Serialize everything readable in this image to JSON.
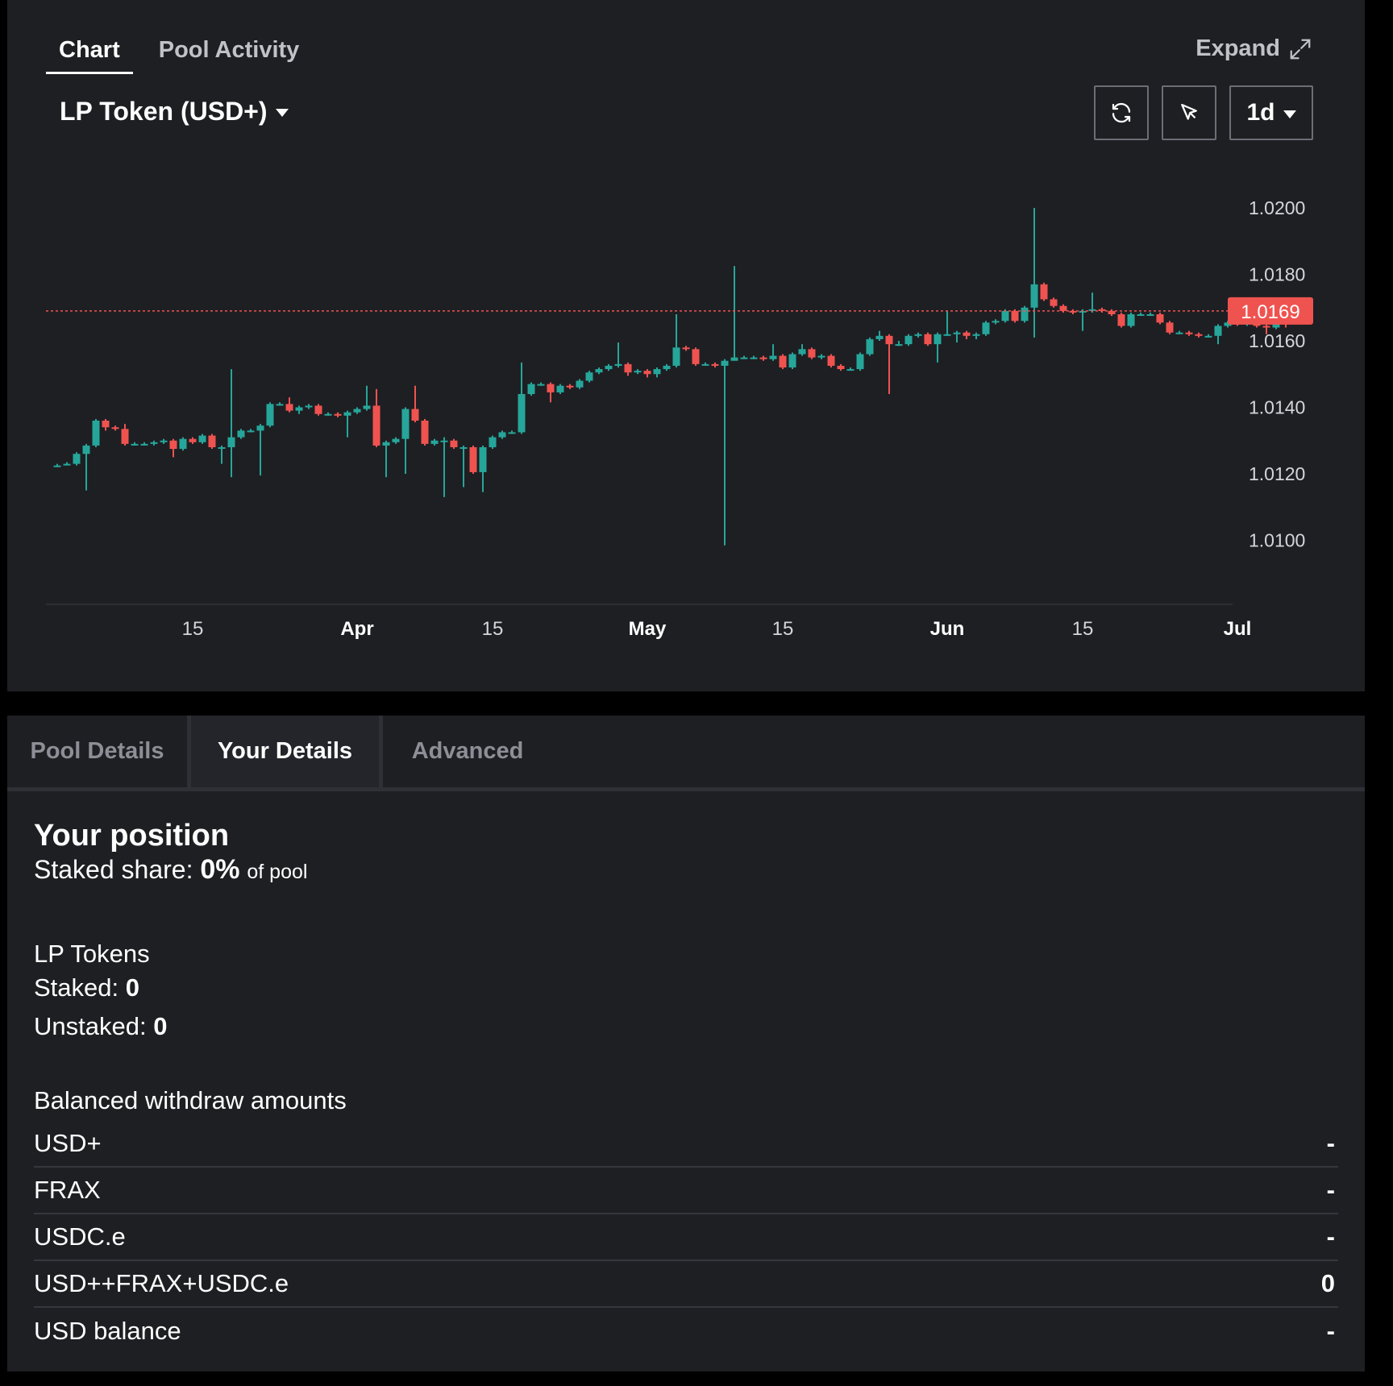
{
  "top_tabs": [
    "Chart",
    "Pool Activity"
  ],
  "expand_label": "Expand",
  "token_select": "LP Token (USD+)",
  "interval": "1d",
  "icons": {
    "refresh": "refresh-icon",
    "cursor": "cursor-icon",
    "expand": "expand-icon",
    "dropdown": "chevron-down-icon"
  },
  "colors": {
    "up": "#26a69a",
    "down": "#ef5350",
    "background": "#1e1f23",
    "price_tag": "#ef5350"
  },
  "chart_data": {
    "type": "candlestick",
    "y_ticks": [
      "1.0200",
      "1.0180",
      "1.0160",
      "1.0140",
      "1.0120",
      "1.0100"
    ],
    "y_tick_values": [
      1.02,
      1.018,
      1.016,
      1.014,
      1.012,
      1.01
    ],
    "ylim": [
      1.0095,
      1.0215
    ],
    "x_ticks": [
      {
        "label": "15",
        "bold": false,
        "day": 14
      },
      {
        "label": "Apr",
        "bold": true,
        "day": 31
      },
      {
        "label": "15",
        "bold": false,
        "day": 45
      },
      {
        "label": "May",
        "bold": true,
        "day": 61
      },
      {
        "label": "15",
        "bold": false,
        "day": 75
      },
      {
        "label": "Jun",
        "bold": true,
        "day": 92
      },
      {
        "label": "15",
        "bold": false,
        "day": 106
      },
      {
        "label": "Jul",
        "bold": true,
        "day": 122
      }
    ],
    "current_price": "1.0169",
    "current_value": 1.0169,
    "candles": [
      [
        1.01225,
        1.01225,
        1.0122,
        1.0123
      ],
      [
        1.0123,
        1.0123,
        1.01225,
        1.01235
      ],
      [
        1.0123,
        1.0126,
        1.01225,
        1.01265
      ],
      [
        1.0126,
        1.01285,
        1.0115,
        1.0129
      ],
      [
        1.01285,
        1.0136,
        1.0128,
        1.01365
      ],
      [
        1.0136,
        1.0134,
        1.0133,
        1.01365
      ],
      [
        1.0134,
        1.01335,
        1.0133,
        1.01345
      ],
      [
        1.01335,
        1.0129,
        1.01285,
        1.0135
      ],
      [
        1.0129,
        1.0129,
        1.01285,
        1.01295
      ],
      [
        1.0129,
        1.0129,
        1.01285,
        1.01295
      ],
      [
        1.0129,
        1.01295,
        1.01285,
        1.013
      ],
      [
        1.01295,
        1.013,
        1.0129,
        1.01305
      ],
      [
        1.013,
        1.01275,
        1.0125,
        1.01305
      ],
      [
        1.01275,
        1.01305,
        1.0127,
        1.0131
      ],
      [
        1.01305,
        1.01295,
        1.0129,
        1.0131
      ],
      [
        1.01295,
        1.01315,
        1.0129,
        1.0132
      ],
      [
        1.01315,
        1.0128,
        1.01275,
        1.0132
      ],
      [
        1.0128,
        1.0128,
        1.0123,
        1.01285
      ],
      [
        1.0128,
        1.0131,
        1.0119,
        1.01515
      ],
      [
        1.0131,
        1.0133,
        1.01305,
        1.01335
      ],
      [
        1.0133,
        1.0133,
        1.01325,
        1.01335
      ],
      [
        1.0133,
        1.01345,
        1.01195,
        1.0135
      ],
      [
        1.01345,
        1.0141,
        1.0134,
        1.01415
      ],
      [
        1.0141,
        1.0141,
        1.01405,
        1.01415
      ],
      [
        1.0141,
        1.0139,
        1.01385,
        1.0143
      ],
      [
        1.0139,
        1.014,
        1.0138,
        1.01405
      ],
      [
        1.014,
        1.01405,
        1.01395,
        1.0141
      ],
      [
        1.01405,
        1.0138,
        1.01375,
        1.0141
      ],
      [
        1.0138,
        1.0138,
        1.01375,
        1.01385
      ],
      [
        1.0138,
        1.01375,
        1.0137,
        1.01385
      ],
      [
        1.01375,
        1.01385,
        1.0131,
        1.0139
      ],
      [
        1.01385,
        1.01395,
        1.0138,
        1.014
      ],
      [
        1.01395,
        1.01405,
        1.0139,
        1.01465
      ],
      [
        1.01405,
        1.01285,
        1.0128,
        1.01455
      ],
      [
        1.01285,
        1.01295,
        1.0119,
        1.013
      ],
      [
        1.01295,
        1.01305,
        1.0129,
        1.0131
      ],
      [
        1.01305,
        1.01395,
        1.012,
        1.014
      ],
      [
        1.01395,
        1.0136,
        1.01355,
        1.01465
      ],
      [
        1.0136,
        1.0129,
        1.01285,
        1.01365
      ],
      [
        1.0129,
        1.013,
        1.01285,
        1.01305
      ],
      [
        1.013,
        1.013,
        1.0113,
        1.0131
      ],
      [
        1.013,
        1.0128,
        1.01275,
        1.01305
      ],
      [
        1.0128,
        1.0128,
        1.0116,
        1.01285
      ],
      [
        1.0128,
        1.01205,
        1.012,
        1.01285
      ],
      [
        1.01205,
        1.0128,
        1.01145,
        1.01285
      ],
      [
        1.0128,
        1.0131,
        1.01275,
        1.01315
      ],
      [
        1.0131,
        1.01325,
        1.01305,
        1.0133
      ],
      [
        1.01325,
        1.01325,
        1.0132,
        1.0133
      ],
      [
        1.01325,
        1.0144,
        1.0132,
        1.01535
      ],
      [
        1.0144,
        1.0147,
        1.01435,
        1.01475
      ],
      [
        1.0147,
        1.0147,
        1.01465,
        1.01475
      ],
      [
        1.0147,
        1.01445,
        1.01415,
        1.01475
      ],
      [
        1.01445,
        1.01465,
        1.0144,
        1.0147
      ],
      [
        1.01465,
        1.0146,
        1.01455,
        1.0147
      ],
      [
        1.0146,
        1.0148,
        1.01455,
        1.01485
      ],
      [
        1.0148,
        1.01505,
        1.01475,
        1.0151
      ],
      [
        1.01505,
        1.01515,
        1.015,
        1.0152
      ],
      [
        1.01515,
        1.01525,
        1.0151,
        1.0153
      ],
      [
        1.01525,
        1.0153,
        1.0152,
        1.01595
      ],
      [
        1.0153,
        1.01505,
        1.01495,
        1.01535
      ],
      [
        1.01505,
        1.0151,
        1.015,
        1.01515
      ],
      [
        1.0151,
        1.015,
        1.0149,
        1.01515
      ],
      [
        1.015,
        1.01515,
        1.0149,
        1.0152
      ],
      [
        1.01515,
        1.01525,
        1.0151,
        1.0153
      ],
      [
        1.01525,
        1.0158,
        1.0152,
        1.0168
      ],
      [
        1.0158,
        1.01575,
        1.0157,
        1.01585
      ],
      [
        1.01575,
        1.0153,
        1.01525,
        1.0158
      ],
      [
        1.0153,
        1.0153,
        1.01525,
        1.01535
      ],
      [
        1.0153,
        1.01525,
        1.0152,
        1.01535
      ],
      [
        1.01525,
        1.0154,
        1.00985,
        1.01545
      ],
      [
        1.0154,
        1.0155,
        1.01545,
        1.01825
      ],
      [
        1.0155,
        1.0155,
        1.01545,
        1.01555
      ],
      [
        1.0155,
        1.0155,
        1.01545,
        1.01555
      ],
      [
        1.0155,
        1.01545,
        1.0154,
        1.01555
      ],
      [
        1.01545,
        1.01555,
        1.0154,
        1.0159
      ],
      [
        1.01555,
        1.0152,
        1.01515,
        1.0156
      ],
      [
        1.0152,
        1.0156,
        1.01515,
        1.01565
      ],
      [
        1.0156,
        1.01575,
        1.01555,
        1.0159
      ],
      [
        1.01575,
        1.0155,
        1.01545,
        1.0158
      ],
      [
        1.0155,
        1.01555,
        1.01545,
        1.0156
      ],
      [
        1.01555,
        1.01525,
        1.0152,
        1.0156
      ],
      [
        1.01525,
        1.01515,
        1.0151,
        1.0153
      ],
      [
        1.01515,
        1.01515,
        1.0151,
        1.0152
      ],
      [
        1.01515,
        1.0156,
        1.0151,
        1.01565
      ],
      [
        1.0156,
        1.01605,
        1.01555,
        1.0161
      ],
      [
        1.01605,
        1.01615,
        1.016,
        1.0163
      ],
      [
        1.01615,
        1.0159,
        1.0144,
        1.0162
      ],
      [
        1.0159,
        1.0159,
        1.01585,
        1.016
      ],
      [
        1.0159,
        1.01615,
        1.01585,
        1.0162
      ],
      [
        1.01615,
        1.0162,
        1.0161,
        1.01625
      ],
      [
        1.0162,
        1.0159,
        1.01585,
        1.01625
      ],
      [
        1.0159,
        1.0162,
        1.01535,
        1.01625
      ],
      [
        1.0162,
        1.0162,
        1.01615,
        1.0169
      ],
      [
        1.0162,
        1.01625,
        1.01595,
        1.0163
      ],
      [
        1.01625,
        1.01615,
        1.01605,
        1.0163
      ],
      [
        1.01615,
        1.0162,
        1.01605,
        1.01625
      ],
      [
        1.0162,
        1.01655,
        1.01615,
        1.0166
      ],
      [
        1.01655,
        1.0166,
        1.0165,
        1.01665
      ],
      [
        1.0166,
        1.0169,
        1.01655,
        1.01695
      ],
      [
        1.0169,
        1.0166,
        1.01655,
        1.01695
      ],
      [
        1.0166,
        1.017,
        1.01655,
        1.01705
      ],
      [
        1.017,
        1.0177,
        1.0161,
        1.02
      ],
      [
        1.0177,
        1.01725,
        1.0172,
        1.01775
      ],
      [
        1.01725,
        1.01705,
        1.017,
        1.0173
      ],
      [
        1.01705,
        1.0169,
        1.01685,
        1.0171
      ],
      [
        1.0169,
        1.01685,
        1.0168,
        1.01695
      ],
      [
        1.01685,
        1.0169,
        1.0163,
        1.01695
      ],
      [
        1.0169,
        1.01695,
        1.01685,
        1.01745
      ],
      [
        1.01695,
        1.0169,
        1.01685,
        1.017
      ],
      [
        1.0169,
        1.0168,
        1.01675,
        1.01695
      ],
      [
        1.0168,
        1.01645,
        1.0164,
        1.01685
      ],
      [
        1.01645,
        1.0168,
        1.0164,
        1.01685
      ],
      [
        1.0168,
        1.0168,
        1.01675,
        1.01685
      ],
      [
        1.0168,
        1.0168,
        1.01675,
        1.01685
      ],
      [
        1.0168,
        1.01655,
        1.0165,
        1.01685
      ],
      [
        1.01655,
        1.01625,
        1.0162,
        1.0166
      ],
      [
        1.01625,
        1.01625,
        1.0162,
        1.0163
      ],
      [
        1.01625,
        1.0162,
        1.01615,
        1.0163
      ],
      [
        1.0162,
        1.01615,
        1.0161,
        1.01625
      ],
      [
        1.01615,
        1.01615,
        1.0161,
        1.0162
      ],
      [
        1.01615,
        1.01645,
        1.0159,
        1.0165
      ],
      [
        1.01645,
        1.01655,
        1.0164,
        1.0166
      ],
      [
        1.01655,
        1.0165,
        1.01645,
        1.0166
      ],
      [
        1.0165,
        1.01655,
        1.01645,
        1.0166
      ],
      [
        1.01655,
        1.01645,
        1.0164,
        1.0166
      ],
      [
        1.01645,
        1.0164,
        1.0162,
        1.0165
      ],
      [
        1.0164,
        1.01695,
        1.01635,
        1.017
      ],
      [
        1.01695,
        1.0169,
        1.0164,
        1.017
      ]
    ]
  },
  "detail_tabs": [
    "Pool Details",
    "Your Details",
    "Advanced"
  ],
  "position": {
    "title": "Your position",
    "staked_share_label": "Staked share:",
    "staked_share_value": "0%",
    "staked_share_suffix": "of pool"
  },
  "lp_tokens": {
    "title": "LP Tokens",
    "staked_label": "Staked:",
    "staked_value": "0",
    "unstaked_label": "Unstaked:",
    "unstaked_value": "0"
  },
  "withdraw": {
    "title": "Balanced withdraw amounts",
    "rows": [
      {
        "label": "USD+",
        "value": "-"
      },
      {
        "label": "FRAX",
        "value": "-"
      },
      {
        "label": "USDC.e",
        "value": "-"
      },
      {
        "label": "USD++FRAX+USDC.e",
        "value": "0"
      },
      {
        "label": "USD balance",
        "value": "-"
      }
    ]
  }
}
